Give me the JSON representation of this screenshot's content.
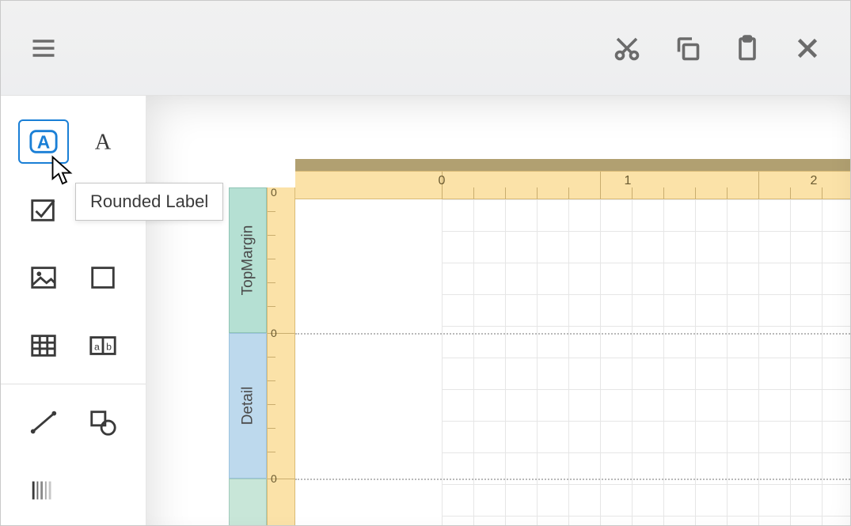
{
  "toolbar": {
    "actions": {
      "cut_name": "cut-icon",
      "copy_name": "copy-icon",
      "paste_name": "paste-icon",
      "close_name": "close-icon",
      "menu_name": "menu-hamburger-icon"
    }
  },
  "toolbox": {
    "items": [
      {
        "name": "rounded-label-tool",
        "selected": true
      },
      {
        "name": "label-tool"
      },
      {
        "name": "checkbox-tool"
      },
      {
        "name": "picture-tool"
      },
      {
        "name": "panel-tool"
      },
      {
        "name": "table-tool"
      },
      {
        "name": "cell-tool"
      },
      {
        "name": "line-tool"
      },
      {
        "name": "shape-tool"
      },
      {
        "name": "barcode-tool"
      }
    ],
    "tooltip": "Rounded Label"
  },
  "designer": {
    "bands": [
      {
        "label": "TopMargin"
      },
      {
        "label": "Detail"
      }
    ],
    "hruler_ticks": [
      "0",
      "1",
      "2"
    ],
    "vruler_ticks": [
      "0",
      "0",
      "0"
    ]
  }
}
